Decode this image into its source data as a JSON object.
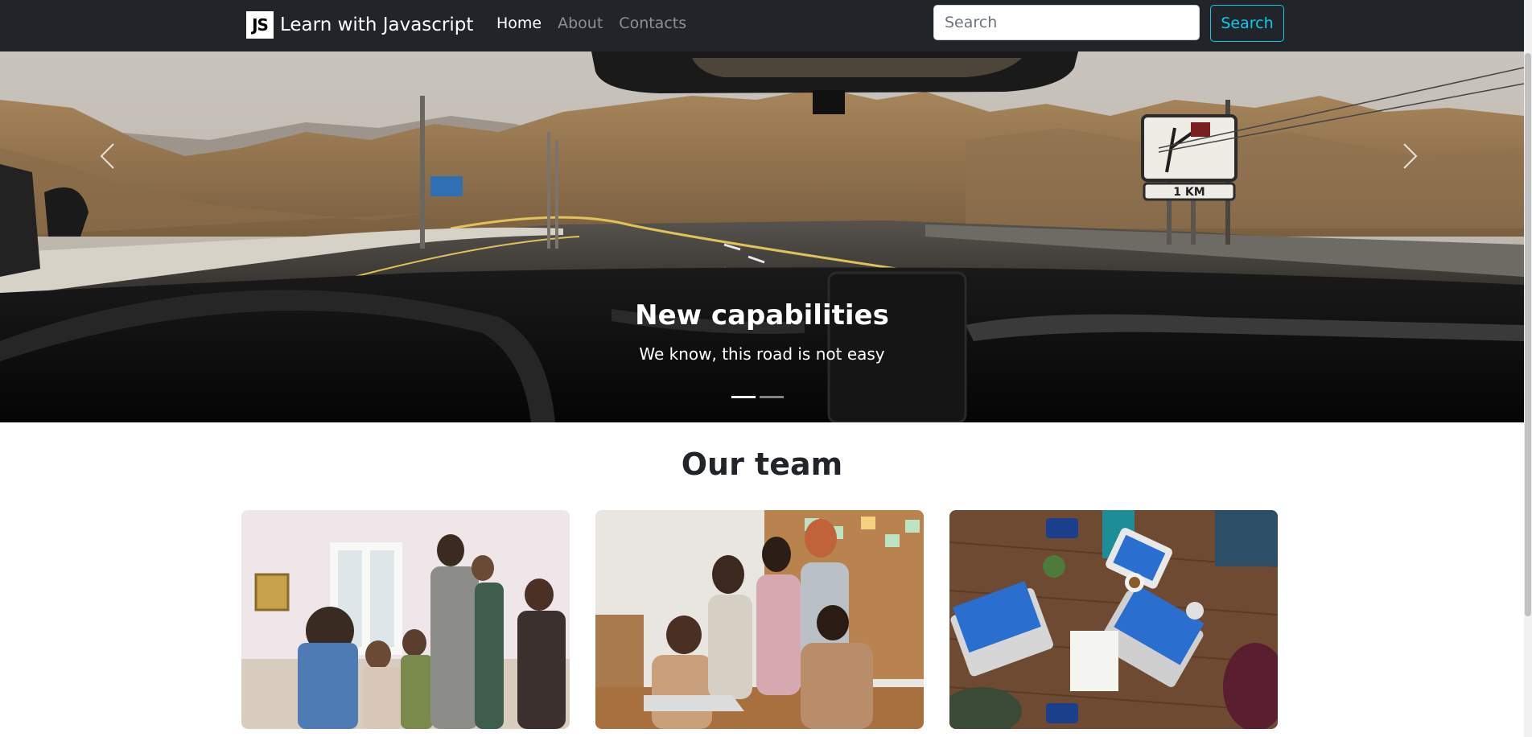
{
  "navbar": {
    "brand_logo": "JS",
    "brand_text": "Learn with Javascript",
    "links": [
      {
        "label": "Home",
        "active": true
      },
      {
        "label": "About",
        "active": false
      },
      {
        "label": "Contacts",
        "active": false
      }
    ],
    "search_placeholder": "Search",
    "search_button": "Search"
  },
  "carousel": {
    "slides": [
      {
        "title": "New capabilities",
        "text": "We know, this road is not easy",
        "active": true
      },
      {
        "active": false
      }
    ],
    "prev_icon": "chevron-left-icon",
    "next_icon": "chevron-right-icon",
    "sign_text": "1 KM"
  },
  "team": {
    "title": "Our team",
    "cards": [
      {
        "image": "people-meeting-photo"
      },
      {
        "image": "team-around-laptop-photo"
      },
      {
        "image": "desk-with-laptops-photo"
      }
    ]
  },
  "colors": {
    "navbar_bg": "#212529",
    "accent": "#0dcaf0",
    "link_muted": "#8c8f93"
  }
}
